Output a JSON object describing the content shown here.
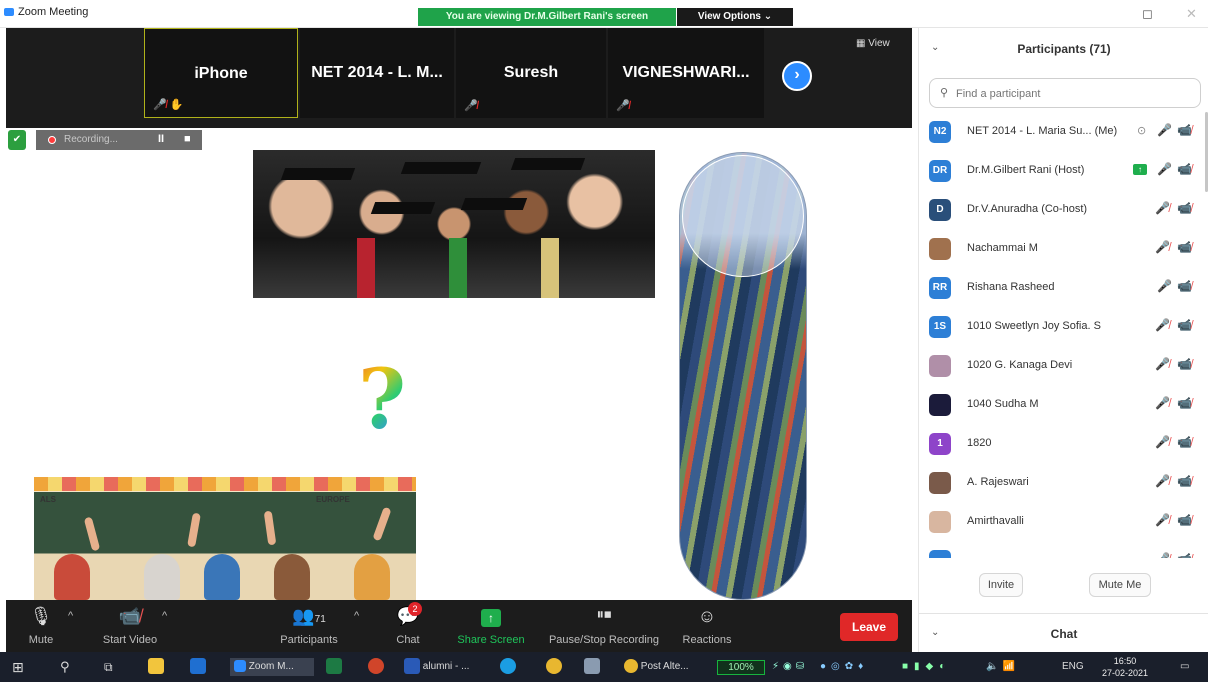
{
  "window": {
    "title": "Zoom Meeting",
    "viewing_banner": "You are viewing Dr.M.Gilbert Rani's screen",
    "view_options": "View Options ⌄",
    "minimize_glyph": "◻",
    "close_glyph": "✕"
  },
  "thumbnails": [
    {
      "name": "iPhone",
      "muted": true
    },
    {
      "name": "NET 2014 - L. M...",
      "muted": false
    },
    {
      "name": "Suresh",
      "muted": true
    },
    {
      "name": "VIGNESHWARI...",
      "muted": true
    }
  ],
  "strip": {
    "view_label": "▦ View",
    "next_glyph": "›"
  },
  "recording": {
    "label": "Recording...",
    "pause": "II",
    "stop": "■"
  },
  "toolbar": {
    "mute": "Mute",
    "start_video": "Start Video",
    "participants": "Participants",
    "participants_count": "71",
    "chat": "Chat",
    "chat_badge": "2",
    "share_screen": "Share Screen",
    "pause_stop_recording": "Pause/Stop Recording",
    "reactions": "Reactions",
    "leave": "Leave"
  },
  "panel": {
    "title": "Participants (71)",
    "search_placeholder": "Find a participant",
    "invite": "Invite",
    "mute_me": "Mute Me",
    "chat_title": "Chat"
  },
  "participants": [
    {
      "initials": "N2",
      "name": "NET 2014 - L. Maria Su... (Me)",
      "color": "#2d7fd6",
      "mic": "on",
      "extra": "rename"
    },
    {
      "initials": "DR",
      "name": "Dr.M.Gilbert Rani (Host)",
      "color": "#2d7fd6",
      "mic": "on",
      "extra": "share"
    },
    {
      "initials": "D",
      "name": "Dr.V.Anuradha (Co-host)",
      "color": "#2a4f7a",
      "mic": "muted",
      "extra": ""
    },
    {
      "initials": "",
      "name": "Nachammai M",
      "color": "#a0714e",
      "mic": "muted",
      "extra": ""
    },
    {
      "initials": "RR",
      "name": "Rishana Rasheed",
      "color": "#2d7fd6",
      "mic": "on",
      "extra": ""
    },
    {
      "initials": "1S",
      "name": "1010 Sweetlyn Joy Sofia. S",
      "color": "#2d7fd6",
      "mic": "muted",
      "extra": ""
    },
    {
      "initials": "",
      "name": "1020 G. Kanaga Devi",
      "color": "#b08fa8",
      "mic": "muted",
      "extra": ""
    },
    {
      "initials": "",
      "name": "1040 Sudha M",
      "color": "#1b1b3a",
      "mic": "muted",
      "extra": ""
    },
    {
      "initials": "1",
      "name": "1820",
      "color": "#8e44c9",
      "mic": "muted",
      "extra": ""
    },
    {
      "initials": "",
      "name": "A. Rajeswari",
      "color": "#7a5a4a",
      "mic": "muted",
      "extra": ""
    },
    {
      "initials": "",
      "name": "Amirthavalli",
      "color": "#d8b6a0",
      "mic": "muted",
      "extra": ""
    },
    {
      "initials": "",
      "name": "",
      "color": "#2d7fd6",
      "mic": "muted",
      "extra": ""
    }
  ],
  "taskbar": {
    "zoom_app": "Zoom M...",
    "word_doc": "alumni - ...",
    "chrome_tab": "Post Alte...",
    "zoom_level": "100%",
    "language": "ENG",
    "time": "16:50",
    "date": "27-02-2021"
  },
  "slide": {
    "class_label_left": "ALS",
    "class_label_right": "EUROPE",
    "question_mark": "?"
  }
}
